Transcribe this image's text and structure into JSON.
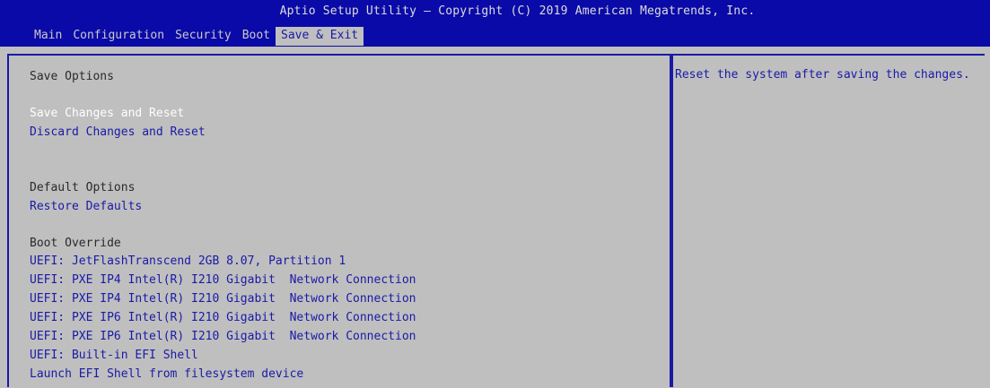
{
  "header": {
    "title": "Aptio Setup Utility – Copyright (C) 2019 American Megatrends, Inc."
  },
  "menu": {
    "items": [
      "Main",
      "Configuration",
      "Security",
      "Boot",
      "Save & Exit"
    ],
    "active": "Save & Exit"
  },
  "save_options": {
    "heading": "Save Options",
    "items": [
      "Save Changes and Reset",
      "Discard Changes and Reset"
    ],
    "selected": "Save Changes and Reset"
  },
  "default_options": {
    "heading": "Default Options",
    "items": [
      "Restore Defaults"
    ]
  },
  "boot_override": {
    "heading": "Boot Override",
    "items": [
      "UEFI: JetFlashTranscend 2GB 8.07, Partition 1",
      "UEFI: PXE IP4 Intel(R) I210 Gigabit  Network Connection",
      "UEFI: PXE IP4 Intel(R) I210 Gigabit  Network Connection",
      "UEFI: PXE IP6 Intel(R) I210 Gigabit  Network Connection",
      "UEFI: PXE IP6 Intel(R) I210 Gigabit  Network Connection",
      "UEFI: Built-in EFI Shell",
      "Launch EFI Shell from filesystem device"
    ]
  },
  "help": {
    "text": "Reset the system after saving the changes."
  },
  "colors": {
    "header_bg": "#0a0aa8",
    "body_bg": "#bfbfbf",
    "item_text": "#1a1aa8",
    "selected_text": "#ffffff",
    "heading_text": "#2a2a2a"
  }
}
